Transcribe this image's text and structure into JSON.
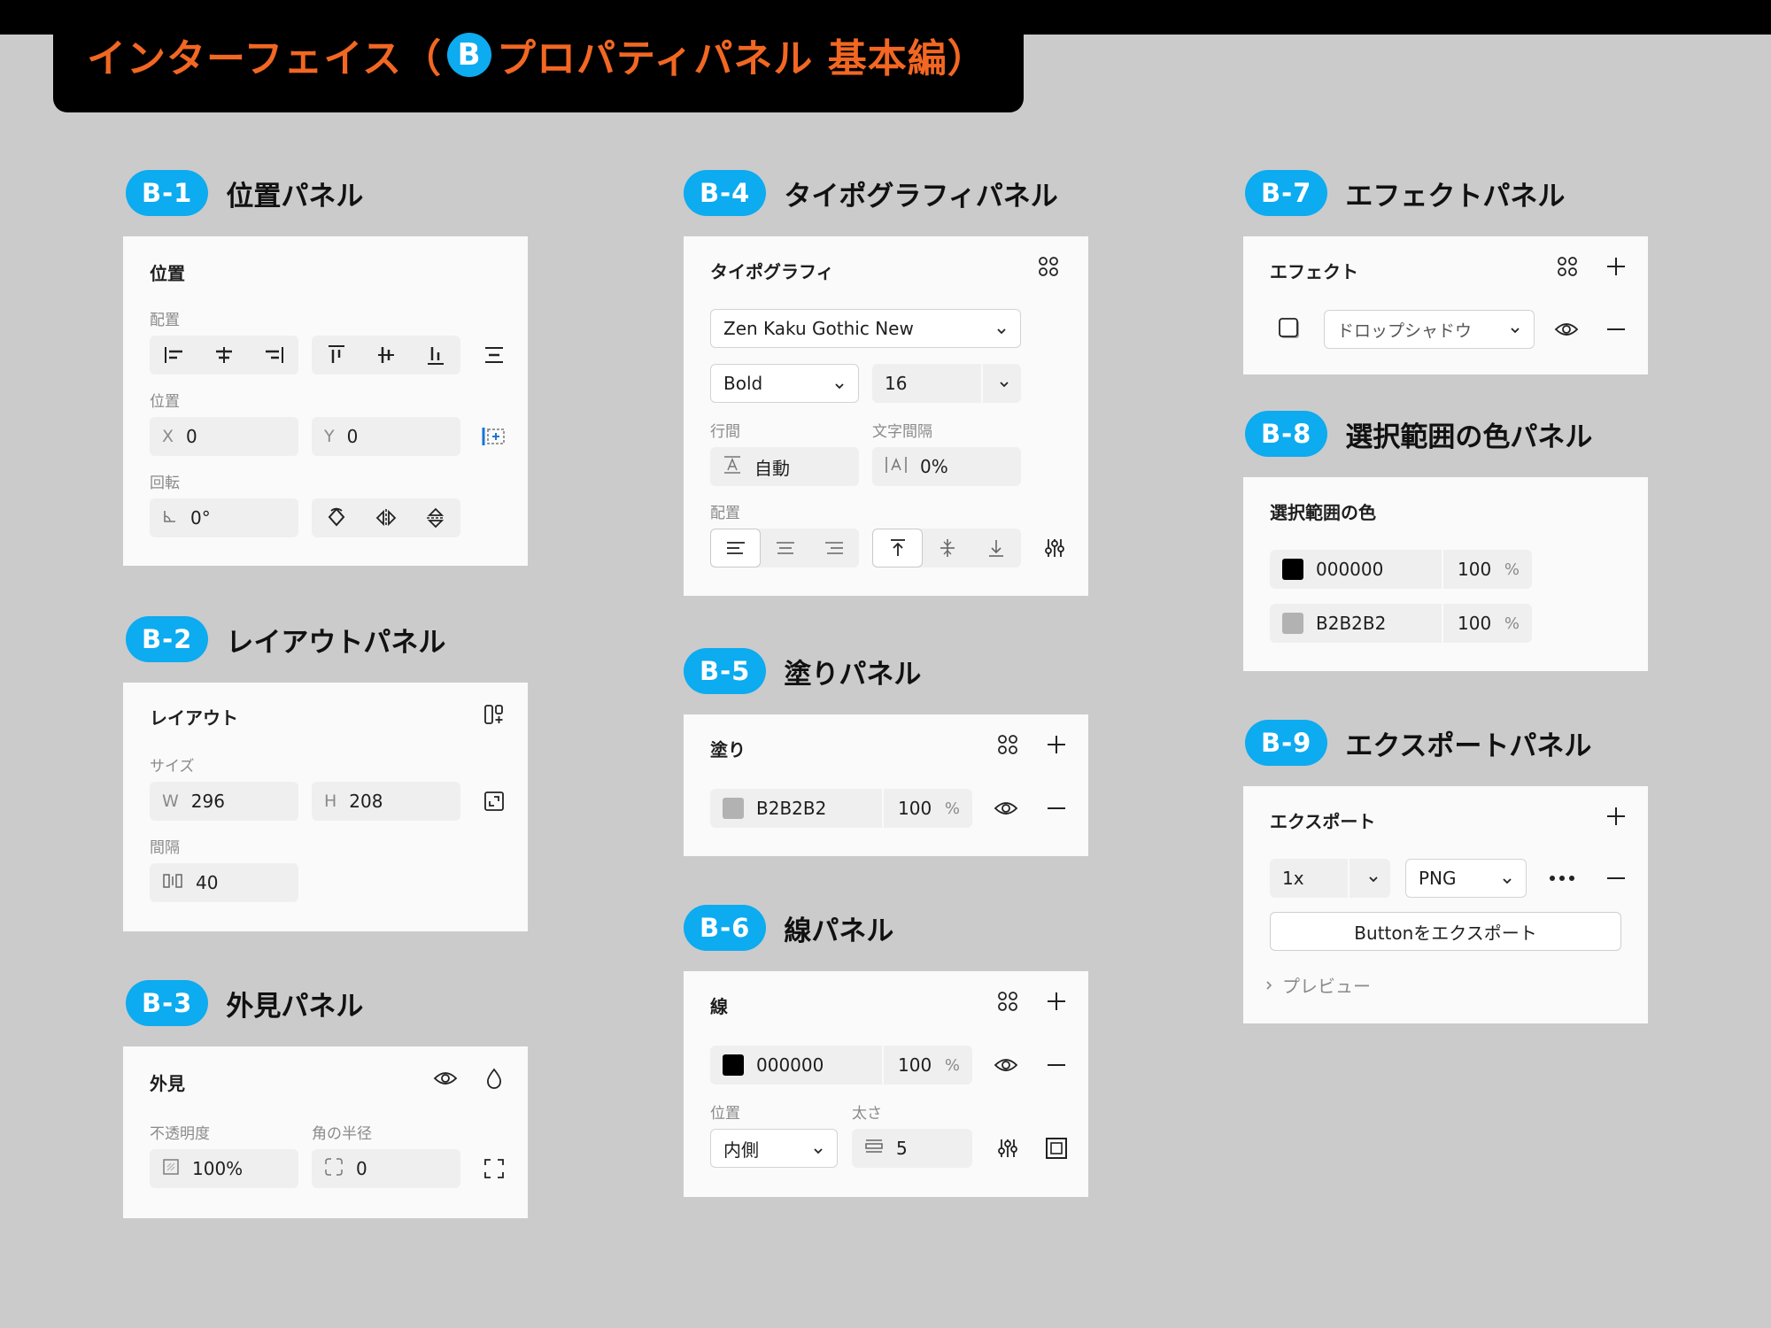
{
  "banner": {
    "title_prefix": "インターフェイス（",
    "b_letter": "B",
    "title_suffix": "プロパティパネル 基本編）"
  },
  "colors": {
    "accent_blue": "#0dabf0",
    "banner_orange": "#f26722",
    "background": "#cbcbcb",
    "panel": "#fafafa"
  },
  "sections": {
    "b1": {
      "tag": "B-1",
      "title": "位置パネル"
    },
    "b2": {
      "tag": "B-2",
      "title": "レイアウトパネル"
    },
    "b3": {
      "tag": "B-3",
      "title": "外見パネル"
    },
    "b4": {
      "tag": "B-4",
      "title": "タイポグラフィパネル"
    },
    "b5": {
      "tag": "B-5",
      "title": "塗りパネル"
    },
    "b6": {
      "tag": "B-6",
      "title": "線パネル"
    },
    "b7": {
      "tag": "B-7",
      "title": "エフェクトパネル"
    },
    "b8": {
      "tag": "B-8",
      "title": "選択範囲の色パネル"
    },
    "b9": {
      "tag": "B-9",
      "title": "エクスポートパネル"
    }
  },
  "position_panel": {
    "title": "位置",
    "align_label": "配置",
    "position_label": "位置",
    "x_prefix": "X",
    "x_value": "0",
    "y_prefix": "Y",
    "y_value": "0",
    "rotation_label": "回転",
    "rotation_value": "0°"
  },
  "layout_panel": {
    "title": "レイアウト",
    "size_label": "サイズ",
    "w_prefix": "W",
    "w_value": "296",
    "h_prefix": "H",
    "h_value": "208",
    "gap_label": "間隔",
    "gap_value": "40"
  },
  "appearance_panel": {
    "title": "外見",
    "opacity_label": "不透明度",
    "opacity_value": "100%",
    "radius_label": "角の半径",
    "radius_value": "0"
  },
  "typography_panel": {
    "title": "タイポグラフィ",
    "font_family": "Zen Kaku Gothic New",
    "font_weight": "Bold",
    "font_size": "16",
    "line_height_label": "行間",
    "line_height_value": "自動",
    "letter_spacing_label": "文字間隔",
    "letter_spacing_value": "0%",
    "align_label": "配置"
  },
  "fill_panel": {
    "title": "塗り",
    "hex": "B2B2B2",
    "opacity": "100",
    "unit": "%",
    "swatch": "#b2b2b2"
  },
  "stroke_panel": {
    "title": "線",
    "hex": "000000",
    "opacity": "100",
    "unit": "%",
    "swatch": "#000000",
    "position_label": "位置",
    "position_value": "内側",
    "weight_label": "太さ",
    "weight_value": "5"
  },
  "effect_panel": {
    "title": "エフェクト",
    "effect_type": "ドロップシャドウ"
  },
  "selection_colors_panel": {
    "title": "選択範囲の色",
    "colors": [
      {
        "hex": "000000",
        "opacity": "100",
        "unit": "%",
        "swatch": "#000000"
      },
      {
        "hex": "B2B2B2",
        "opacity": "100",
        "unit": "%",
        "swatch": "#b2b2b2"
      }
    ]
  },
  "export_panel": {
    "title": "エクスポート",
    "scale": "1x",
    "format": "PNG",
    "export_button": "Buttonをエクスポート",
    "preview_label": "プレビュー"
  }
}
